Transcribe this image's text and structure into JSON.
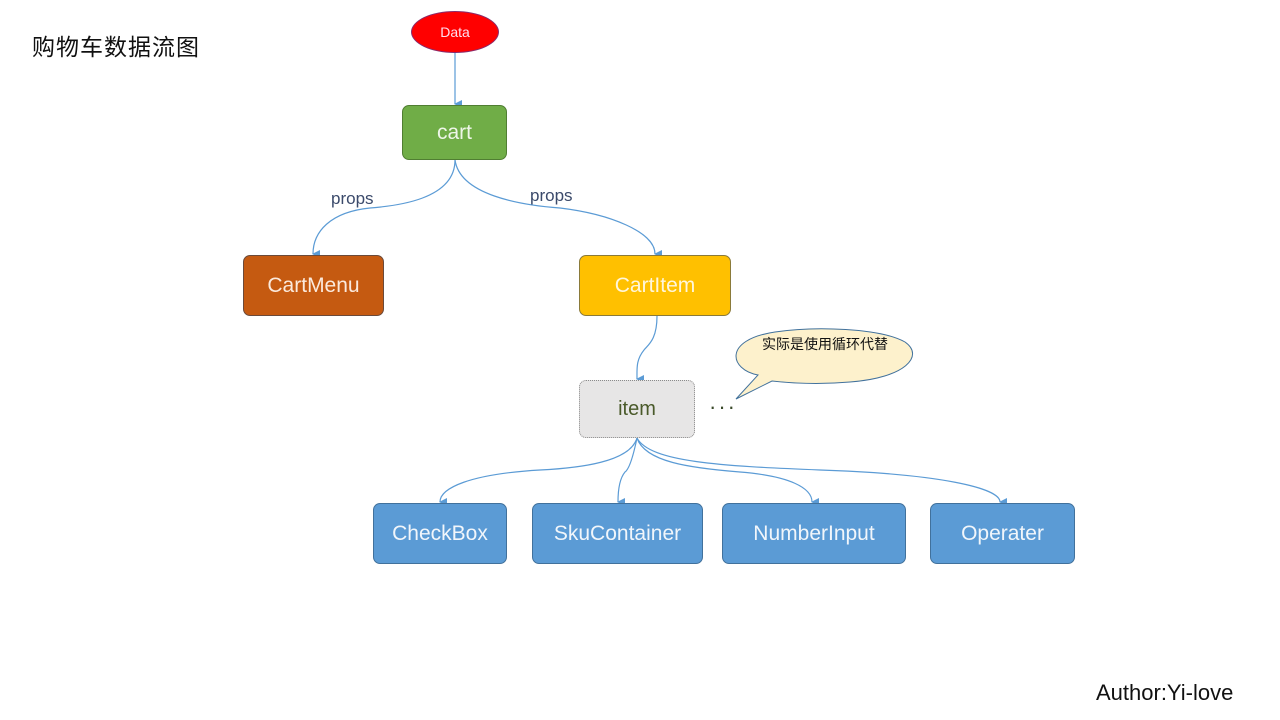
{
  "title": "购物车数据流图",
  "author": "Author:Yi-love",
  "nodes": {
    "data": "Data",
    "cart": "cart",
    "cartmenu": "CartMenu",
    "cartitem": "CartItem",
    "item": "item",
    "checkbox": "CheckBox",
    "skucontainer": "SkuContainer",
    "numberinput": "NumberInput",
    "operater": "Operater"
  },
  "edge_labels": {
    "cart_to_cartmenu": "props",
    "cart_to_cartitem": "props"
  },
  "ellipsis": "···",
  "callout": "实际是使用循环代替",
  "colors": {
    "data": "#ff0000",
    "cart": "#70ad47",
    "cartmenu": "#c55a11",
    "cartitem": "#ffc000",
    "item": "#e7e6e6",
    "leaf": "#5b9bd5",
    "edge": "#5b9bd5",
    "callout": "#fdf1cc"
  }
}
